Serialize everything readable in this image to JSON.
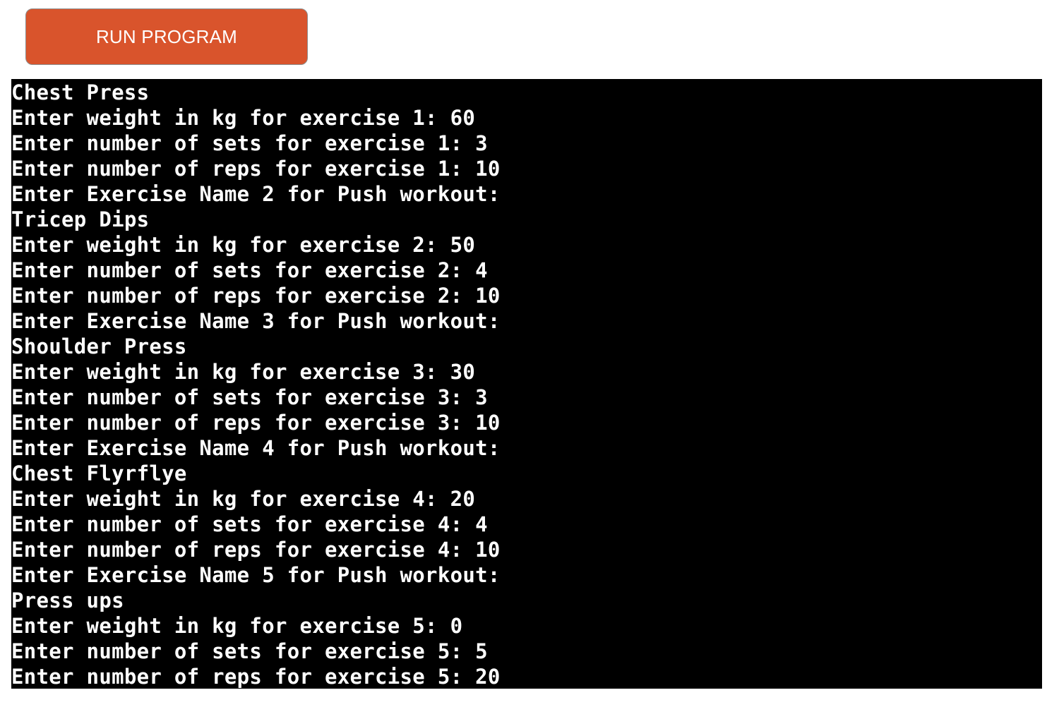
{
  "run_button": {
    "label": "RUN PROGRAM",
    "color": "#d9542c"
  },
  "terminal": {
    "background": "#000000",
    "foreground": "#ffffff",
    "lines": [
      "Chest Press",
      "Enter weight in kg for exercise 1: 60",
      "Enter number of sets for exercise 1: 3",
      "Enter number of reps for exercise 1: 10",
      "Enter Exercise Name 2 for Push workout:",
      "Tricep Dips",
      "Enter weight in kg for exercise 2: 50",
      "Enter number of sets for exercise 2: 4",
      "Enter number of reps for exercise 2: 10",
      "Enter Exercise Name 3 for Push workout:",
      "Shoulder Press",
      "Enter weight in kg for exercise 3: 30",
      "Enter number of sets for exercise 3: 3",
      "Enter number of reps for exercise 3: 10",
      "Enter Exercise Name 4 for Push workout:",
      "Chest Flyrflye",
      "Enter weight in kg for exercise 4: 20",
      "Enter number of sets for exercise 4: 4",
      "Enter number of reps for exercise 4: 10",
      "Enter Exercise Name 5 for Push workout:",
      "Press ups",
      "Enter weight in kg for exercise 5: 0",
      "Enter number of sets for exercise 5: 5",
      "Enter number of reps for exercise 5: 20"
    ]
  }
}
